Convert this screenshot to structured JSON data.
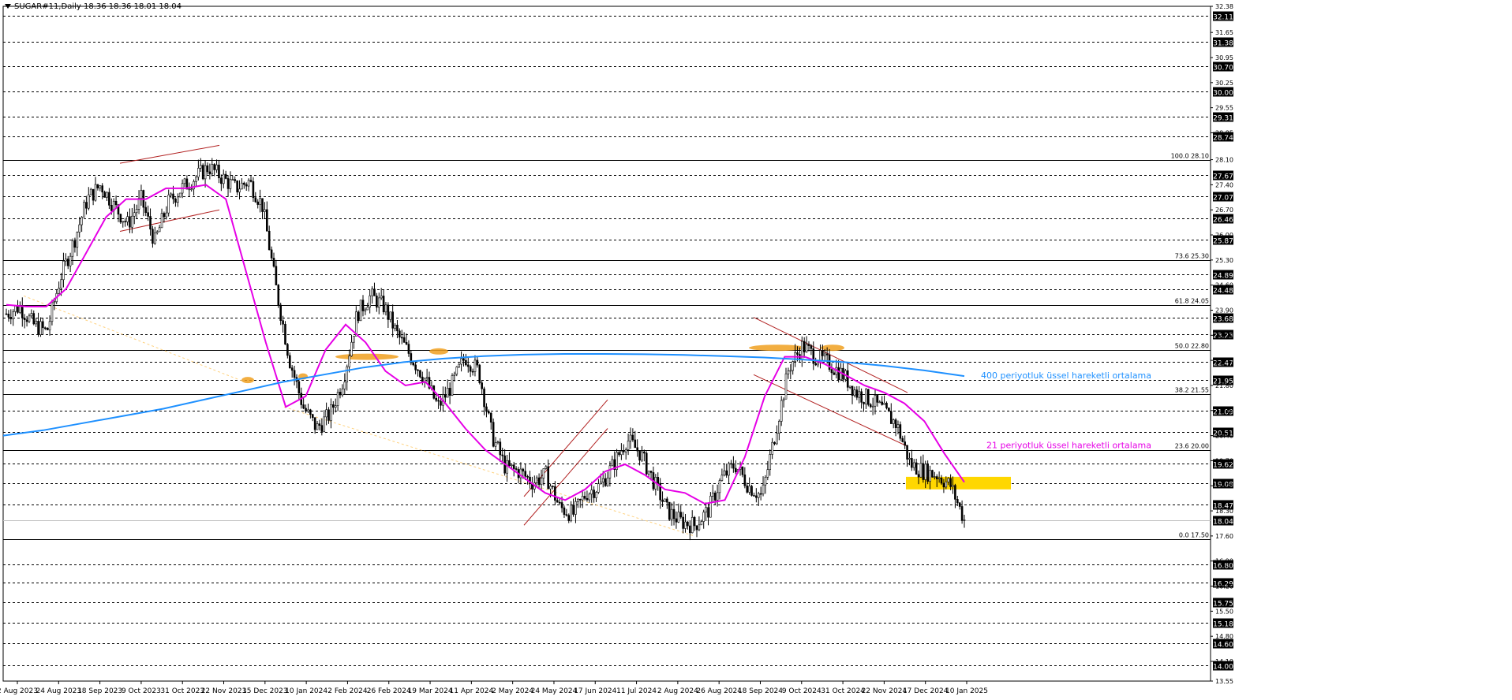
{
  "header": {
    "symbol": "SUGAR#11,Daily",
    "ohlc": "18.36 18.36 18.01 18.04"
  },
  "colors": {
    "background": "#ffffff",
    "grid": "#000000",
    "candle": "#000000",
    "ema21": "#e600e6",
    "ema400": "#1e90ff",
    "zone_orange": "#f0a020",
    "zone_yellow": "#ffd700",
    "channel": "#b22222",
    "trendline": "#ffd27f"
  },
  "chart_data": {
    "type": "candlestick",
    "price_axis": {
      "min": 13.55,
      "max": 32.38,
      "labels": [
        "32.38",
        "31.65",
        "30.95",
        "30.25",
        "29.55",
        "28.85",
        "28.10",
        "27.40",
        "26.70",
        "26.00",
        "25.30",
        "24.60",
        "23.90",
        "23.20",
        "22.50",
        "21.80",
        "21.10",
        "20.40",
        "19.70",
        "19.00",
        "18.30",
        "17.60",
        "16.90",
        "16.20",
        "15.50",
        "14.80",
        "14.10",
        "13.55"
      ],
      "highlighted_labels": [
        "32.11",
        "31.38",
        "30.70",
        "30.00",
        "29.31",
        "28.74",
        "27.67",
        "27.07",
        "26.46",
        "25.87",
        "24.89",
        "24.48",
        "23.68",
        "23.23",
        "22.47",
        "21.95",
        "21.09",
        "20.51",
        "19.62",
        "19.08",
        "18.47",
        "18.04",
        "16.80",
        "16.29",
        "15.75",
        "15.18",
        "14.60",
        "14.00"
      ]
    },
    "time_axis": {
      "labels": [
        "2 Aug 2023",
        "24 Aug 2023",
        "18 Sep 2023",
        "9 Oct 2023",
        "31 Oct 2023",
        "22 Nov 2023",
        "15 Dec 2023",
        "10 Jan 2024",
        "2 Feb 2024",
        "26 Feb 2024",
        "19 Mar 2024",
        "11 Apr 2024",
        "2 May 2024",
        "24 May 2024",
        "17 Jun 2024",
        "11 Jul 2024",
        "2 Aug 2024",
        "26 Aug 2024",
        "18 Sep 2024",
        "9 Oct 2024",
        "31 Oct 2024",
        "22 Nov 2024",
        "17 Dec 2024",
        "10 Jan 2025"
      ]
    },
    "fib_levels": [
      {
        "label": "100.0 28.10",
        "value": 28.1
      },
      {
        "label": "73.6 25.30",
        "value": 25.3
      },
      {
        "label": "61.8 24.05",
        "value": 24.05
      },
      {
        "label": "50.0 22.80",
        "value": 22.8
      },
      {
        "label": "38.2 21.55",
        "value": 21.55
      },
      {
        "label": "23.6 20.00",
        "value": 20.0
      },
      {
        "label": "0.0 17.50",
        "value": 17.5
      }
    ],
    "current_price": 18.04,
    "series": [
      {
        "name": "21 periyotluk üssel hareketli ortalama",
        "values": [
          24.05,
          24.0,
          24.0,
          24.5,
          25.5,
          26.5,
          27.0,
          27.0,
          27.3,
          27.3,
          27.4,
          27.0,
          25.0,
          23.0,
          21.2,
          21.5,
          22.8,
          23.5,
          23.0,
          22.2,
          21.8,
          21.9,
          21.3,
          20.6,
          20.0,
          19.6,
          19.2,
          18.8,
          18.6,
          18.9,
          19.4,
          19.6,
          19.3,
          18.9,
          18.8,
          18.5,
          18.6,
          19.8,
          21.5,
          22.6,
          22.6,
          22.4,
          22.1,
          21.8,
          21.6,
          21.3,
          20.8,
          19.9,
          19.1
        ]
      },
      {
        "name": "400 periyotluk üssel hareketli ortalama",
        "values": [
          20.4,
          20.55,
          20.75,
          20.95,
          21.15,
          21.4,
          21.65,
          21.9,
          22.1,
          22.3,
          22.45,
          22.55,
          22.62,
          22.66,
          22.68,
          22.68,
          22.67,
          22.65,
          22.62,
          22.58,
          22.52,
          22.45,
          22.35,
          22.22,
          22.06
        ]
      }
    ],
    "closes": [
      23.8,
      24.0,
      23.5,
      23.3,
      24.8,
      25.8,
      27.0,
      27.4,
      26.8,
      26.3,
      27.0,
      25.8,
      26.9,
      27.3,
      27.6,
      27.9,
      27.6,
      27.3,
      27.5,
      26.8,
      24.5,
      22.5,
      21.2,
      20.6,
      21.0,
      22.0,
      23.8,
      24.3,
      24.0,
      23.2,
      22.6,
      22.0,
      21.2,
      21.8,
      22.6,
      22.2,
      20.4,
      19.5,
      19.4,
      19.1,
      19.3,
      18.4,
      18.2,
      18.8,
      19.0,
      19.6,
      20.3,
      19.9,
      19.1,
      18.3,
      18.0,
      17.9,
      18.3,
      19.2,
      19.6,
      19.0,
      18.7,
      20.5,
      22.3,
      22.9,
      22.6,
      22.4,
      22.1,
      21.6,
      21.4,
      21.1,
      20.7,
      19.6,
      19.4,
      19.3,
      19.0,
      18.04
    ]
  },
  "annotations": {
    "ema400_label": "400 periyotluk üssel hareketli ortalama",
    "ema21_label": "21 periyotluk üssel hareketli ortalama"
  }
}
